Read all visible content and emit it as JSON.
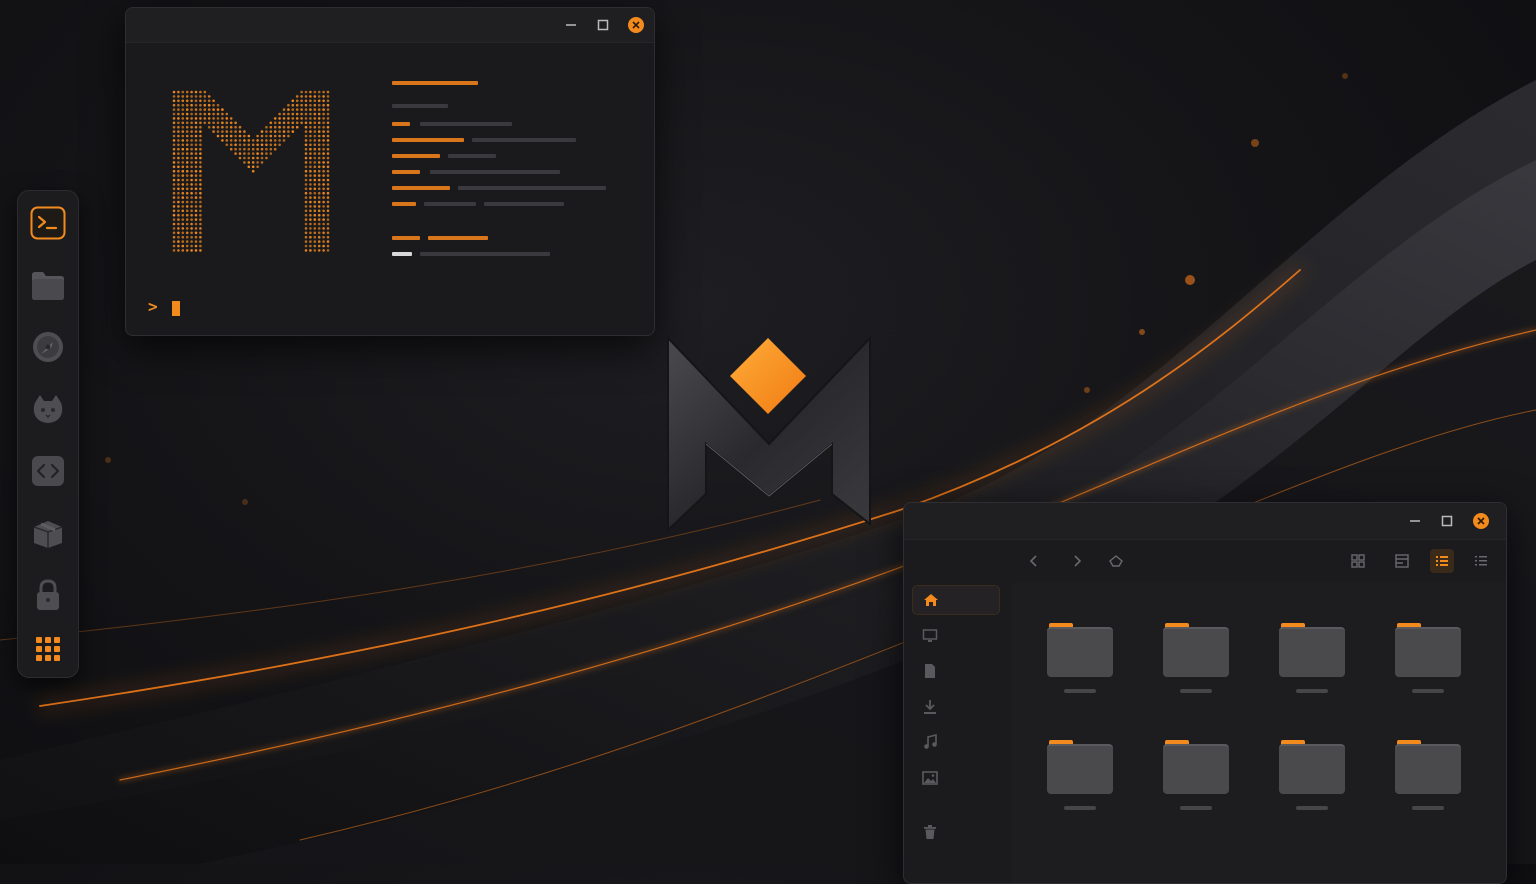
{
  "desktop": {
    "accent_color": "#f28a1e",
    "background_color": "#151518",
    "wallpaper": "dark-orange-waves",
    "center_logo": "m-diamond-logo"
  },
  "dock": {
    "items": [
      {
        "name": "terminal",
        "icon": "terminal-icon",
        "active": true
      },
      {
        "name": "files",
        "icon": "folder-icon"
      },
      {
        "name": "browser",
        "icon": "browser-icon"
      },
      {
        "name": "cat-app",
        "icon": "cat-icon"
      },
      {
        "name": "code-editor",
        "icon": "code-icon"
      },
      {
        "name": "package-manager",
        "icon": "package-icon"
      },
      {
        "name": "lock",
        "icon": "lock-icon"
      },
      {
        "name": "app-grid",
        "icon": "app-grid-icon"
      }
    ]
  },
  "terminal": {
    "prompt_symbol": ">",
    "logo": "dotted-m-logo",
    "controls": [
      "minimize",
      "maximize",
      "close"
    ]
  },
  "file_manager": {
    "toolbar": {
      "nav": [
        "back",
        "forward",
        "home"
      ],
      "view_modes": [
        "grid",
        "compact",
        "list",
        "details"
      ],
      "active_view": "list"
    },
    "sidebar": {
      "items": [
        {
          "name": "home",
          "icon": "home-icon",
          "active": true
        },
        {
          "name": "desktop",
          "icon": "monitor-icon"
        },
        {
          "name": "documents",
          "icon": "document-icon"
        },
        {
          "name": "downloads",
          "icon": "download-icon"
        },
        {
          "name": "music",
          "icon": "music-icon"
        },
        {
          "name": "pictures",
          "icon": "image-icon"
        },
        {
          "name": "trash",
          "icon": "trash-icon"
        }
      ]
    },
    "folder_count": 8
  }
}
